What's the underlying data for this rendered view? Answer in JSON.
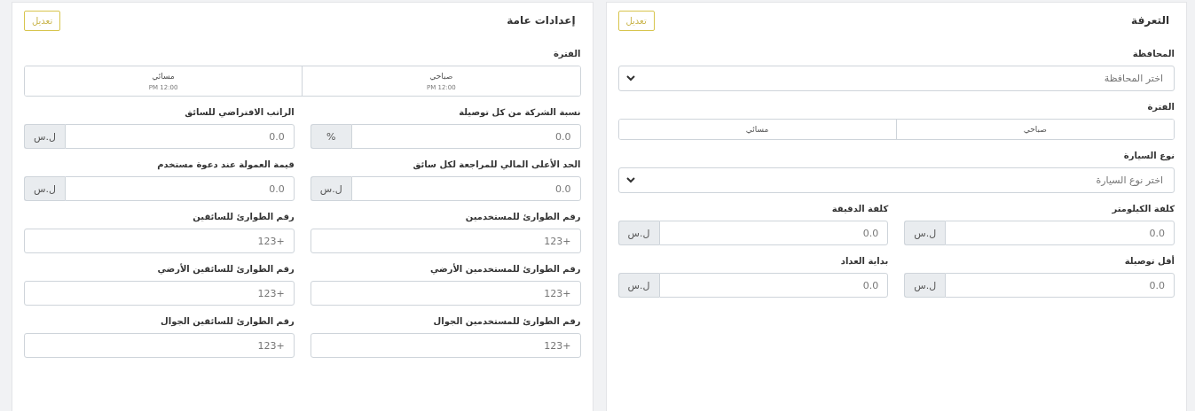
{
  "panels": [
    {
      "title": "التعرفة",
      "edit_button": "تعديل",
      "fields": [
        {
          "kind": "select",
          "label": "المحافظة",
          "placeholder": "اختر المحافظة"
        },
        {
          "kind": "segmented",
          "label": "الفترة",
          "options": [
            {
              "label": "صباحي"
            },
            {
              "label": "مسائي"
            }
          ]
        },
        {
          "kind": "select",
          "label": "نوع السيارة",
          "placeholder": "اختر نوع السيارة"
        },
        {
          "kind": "input",
          "label": "كلفة الكيلومتر",
          "placeholder": "0.0",
          "addon": "ل.س"
        },
        {
          "kind": "input",
          "label": "كلفة الدقيقة",
          "placeholder": "0.0",
          "addon": "ل.س"
        },
        {
          "kind": "input",
          "label": "أقل توصيلة",
          "placeholder": "0.0",
          "addon": "ل.س"
        },
        {
          "kind": "input",
          "label": "بداية العداد",
          "placeholder": "0.0",
          "addon": "ل.س"
        }
      ]
    },
    {
      "title": "إعدادات عامة",
      "edit_button": "تعديل",
      "fields": [
        {
          "kind": "segmented",
          "label": "الفترة",
          "options": [
            {
              "label": "صباحي",
              "time": "12:00 PM"
            },
            {
              "label": "مسائي",
              "time": "12:00 PM"
            }
          ]
        },
        {
          "kind": "input",
          "label": "نسبة الشركة من كل توصيلة",
          "placeholder": "0.0",
          "addon": "%"
        },
        {
          "kind": "input",
          "label": "الراتب الافتراضي للسائق",
          "placeholder": "0.0",
          "addon": "ل.س"
        },
        {
          "kind": "input",
          "label": "الحد الأعلى المالي للمراجعة لكل سائق",
          "placeholder": "0.0",
          "addon": "ل.س"
        },
        {
          "kind": "input",
          "label": "قيمة العمولة عند دعوة مستخدم",
          "placeholder": "0.0",
          "addon": "ل.س"
        },
        {
          "kind": "input",
          "label": "رقم الطوارئ للمستخدمين",
          "placeholder": "+123"
        },
        {
          "kind": "input",
          "label": "رقم الطوارئ للسائقين",
          "placeholder": "+123"
        },
        {
          "kind": "input",
          "label": "رقم الطوارئ للمستخدمين الأرضي",
          "placeholder": "+123"
        },
        {
          "kind": "input",
          "label": "رقم الطوارئ للسائقين الأرضي",
          "placeholder": "+123"
        },
        {
          "kind": "input",
          "label": "رقم الطوارئ للمستخدمين الجوال",
          "placeholder": "+123"
        },
        {
          "kind": "input",
          "label": "رقم الطوارئ للسائقين الجوال",
          "placeholder": "+123"
        }
      ]
    }
  ]
}
